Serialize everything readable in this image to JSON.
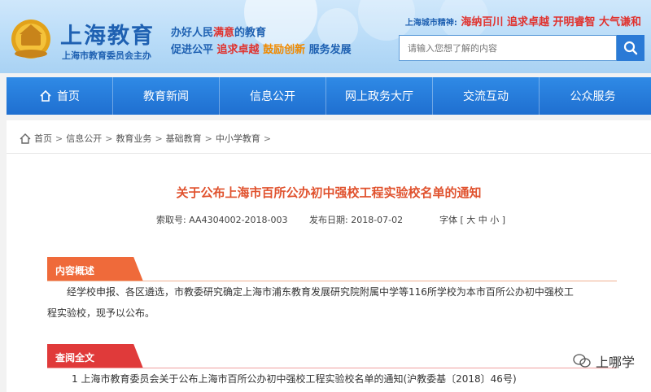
{
  "header": {
    "site_title": "上海教育",
    "site_sub": "上海市教育委员会主办",
    "slogan_line1": [
      "办好人民",
      "满意",
      "的教育"
    ],
    "slogan_line2": [
      "促进公平",
      "追求卓越",
      "鼓励创新",
      "服务发展"
    ],
    "spirit_label": "上海城市精神:",
    "spirit_text": "海纳百川 追求卓越 开明睿智 大气谦和",
    "search_placeholder": "请输入您想了解的内容"
  },
  "nav": [
    {
      "label": "首页",
      "icon": "home-icon"
    },
    {
      "label": "教育新闻"
    },
    {
      "label": "信息公开"
    },
    {
      "label": "网上政务大厅"
    },
    {
      "label": "交流互动"
    },
    {
      "label": "公众服务"
    }
  ],
  "breadcrumb": [
    "首页",
    "信息公开",
    "教育业务",
    "基础教育",
    "中小学教育"
  ],
  "article": {
    "title": "关于公布上海市百所公办初中强校工程实验校名单的通知",
    "index_label": "索取号:",
    "index_value": "AA4304002-2018-003",
    "date_label": "发布日期:",
    "date_value": "2018-07-02",
    "font_label": "字体 [ 大 中 小 ]"
  },
  "sections": {
    "summary_title": "内容概述",
    "summary_line1": "经学校申报、各区遴选，市教委研究确定上海市浦东教育发展研究院附属中学等116所学校为本市百所公办初中强校工",
    "summary_line2": "程实验校，现予以公布。",
    "fulltext_title": "查阅全文",
    "fulltext_item": "1 上海市教育委员会关于公布上海市百所公办初中强校工程实验校名单的通知(沪教委基〔2018〕46号)"
  },
  "watermark": "上哪学",
  "colors": {
    "brand_blue": "#1f61b2",
    "nav_blue": "#2a7ad6",
    "title_orange": "#e0522e",
    "tag_orange": "#ef6a3a",
    "tag_red": "#e03a3a"
  }
}
